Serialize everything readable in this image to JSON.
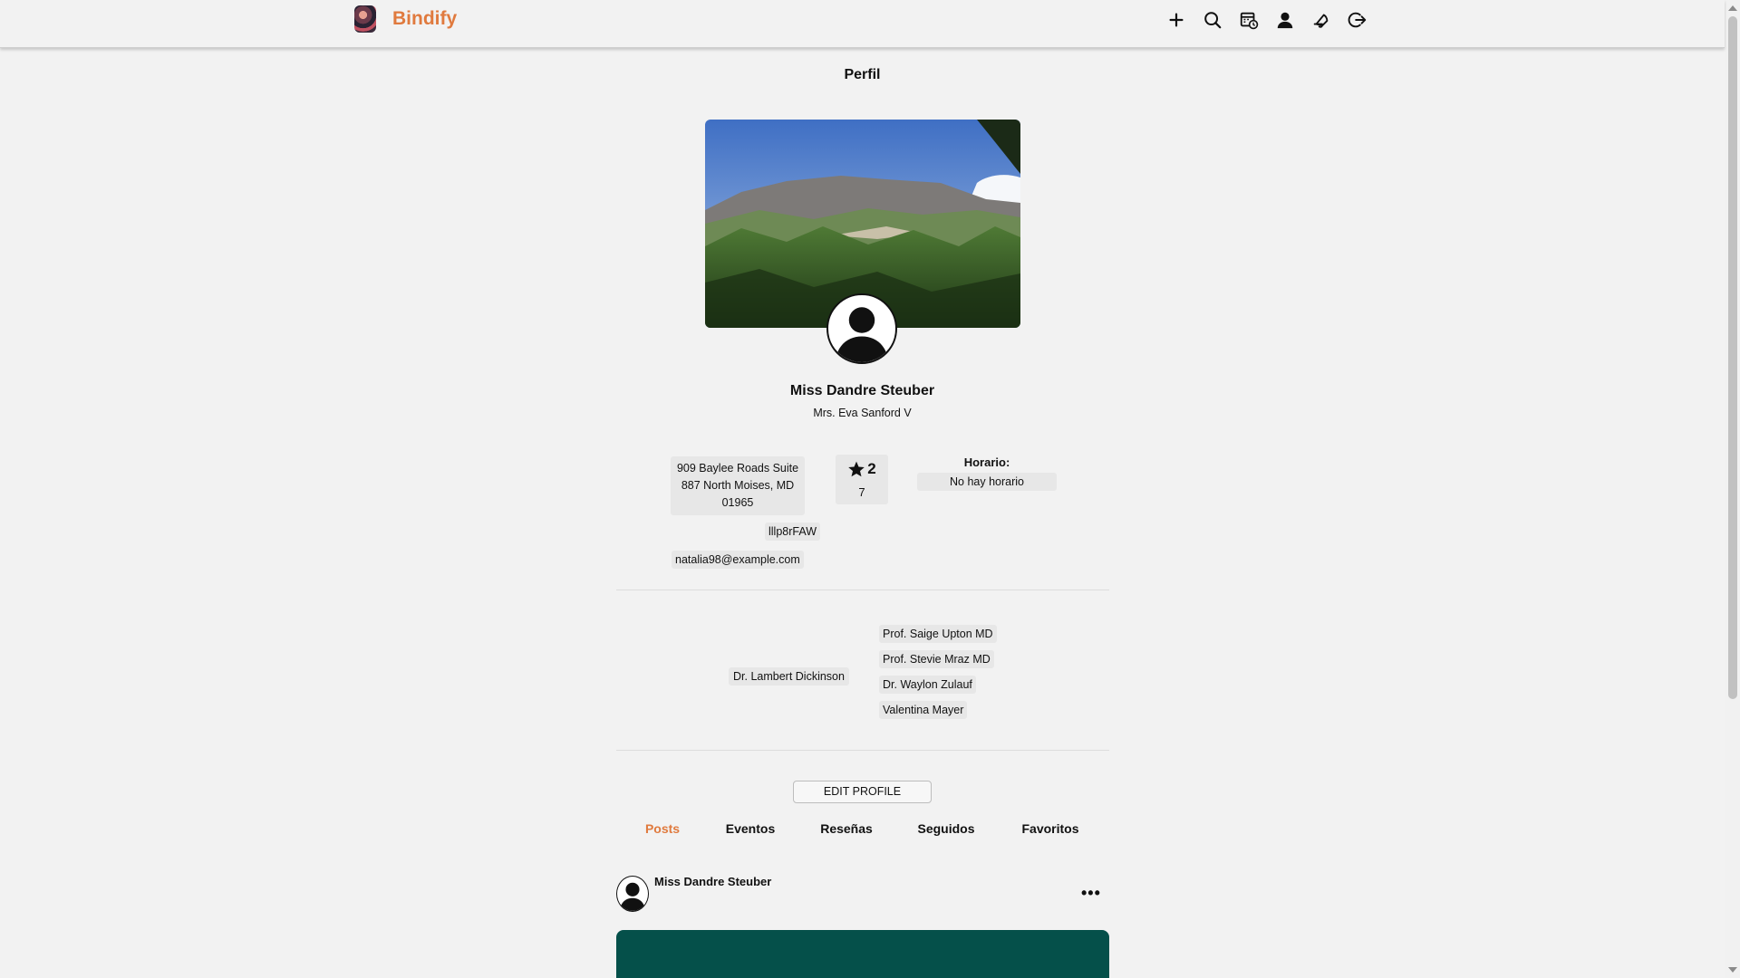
{
  "header": {
    "brand": "Bindify",
    "icons": [
      "plus-icon",
      "search-icon",
      "calendar-clock-icon",
      "user-icon",
      "notification-icon",
      "logout-icon"
    ]
  },
  "profile": {
    "page_title": "Perfil",
    "name": "Miss Dandre Steuber",
    "subtitle": "Mrs. Eva Sanford V",
    "address": "909 Baylee Roads Suite 887 North Moises, MD 01965",
    "code": "lllp8rFAW",
    "email": "natalia98@example.com",
    "rating": "2",
    "rating_count": "7",
    "horario_label": "Horario:",
    "horario_value": "No hay horario"
  },
  "people": {
    "left": "Dr. Lambert Dickinson",
    "right": [
      "Prof. Saige Upton MD",
      "Prof. Stevie Mraz MD",
      "Dr. Waylon Zulauf",
      "Valentina Mayer"
    ]
  },
  "actions": {
    "edit_profile": "EDIT PROFILE"
  },
  "tabs": [
    "Posts",
    "Eventos",
    "Reseñas",
    "Seguidos",
    "Favoritos"
  ],
  "post": {
    "author": "Miss Dandre Steuber",
    "menu": "•••"
  },
  "colors": {
    "accent": "#e07a3e",
    "post_card": "#05504a",
    "background": "#f2f2f2"
  }
}
